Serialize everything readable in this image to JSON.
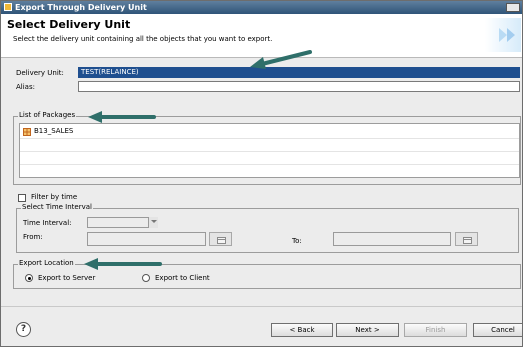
{
  "window": {
    "title": "Export Through Delivery Unit"
  },
  "header": {
    "title": "Select Delivery Unit",
    "description": "Select the delivery unit containing all the objects that you want to export."
  },
  "form": {
    "delivery_unit_label": "Delivery Unit:",
    "delivery_unit_value": "TEST(RELAINCE)",
    "alias_label": "Alias:",
    "alias_value": ""
  },
  "packages": {
    "label": "List of Packages",
    "items": [
      {
        "name": "B13_SALES",
        "icon": "package-icon"
      }
    ]
  },
  "filter": {
    "checkbox_label": "Filter by time",
    "checked": false,
    "group_label": "Select Time Interval",
    "time_interval_label": "Time Interval:",
    "time_interval_value": "",
    "from_label": "From:",
    "from_value": "",
    "to_label": "To:",
    "to_value": ""
  },
  "export_location": {
    "label": "Export Location",
    "options": [
      {
        "label": "Export to Server",
        "checked": true
      },
      {
        "label": "Export to Client",
        "checked": false
      }
    ]
  },
  "footer": {
    "help": "?",
    "back": "< Back",
    "next": "Next >",
    "finish": "Finish",
    "cancel": "Cancel"
  },
  "colors": {
    "title_bar": "#2f5478",
    "selection": "#1f4f8f",
    "annotation_arrow": "#2f6f6a"
  }
}
